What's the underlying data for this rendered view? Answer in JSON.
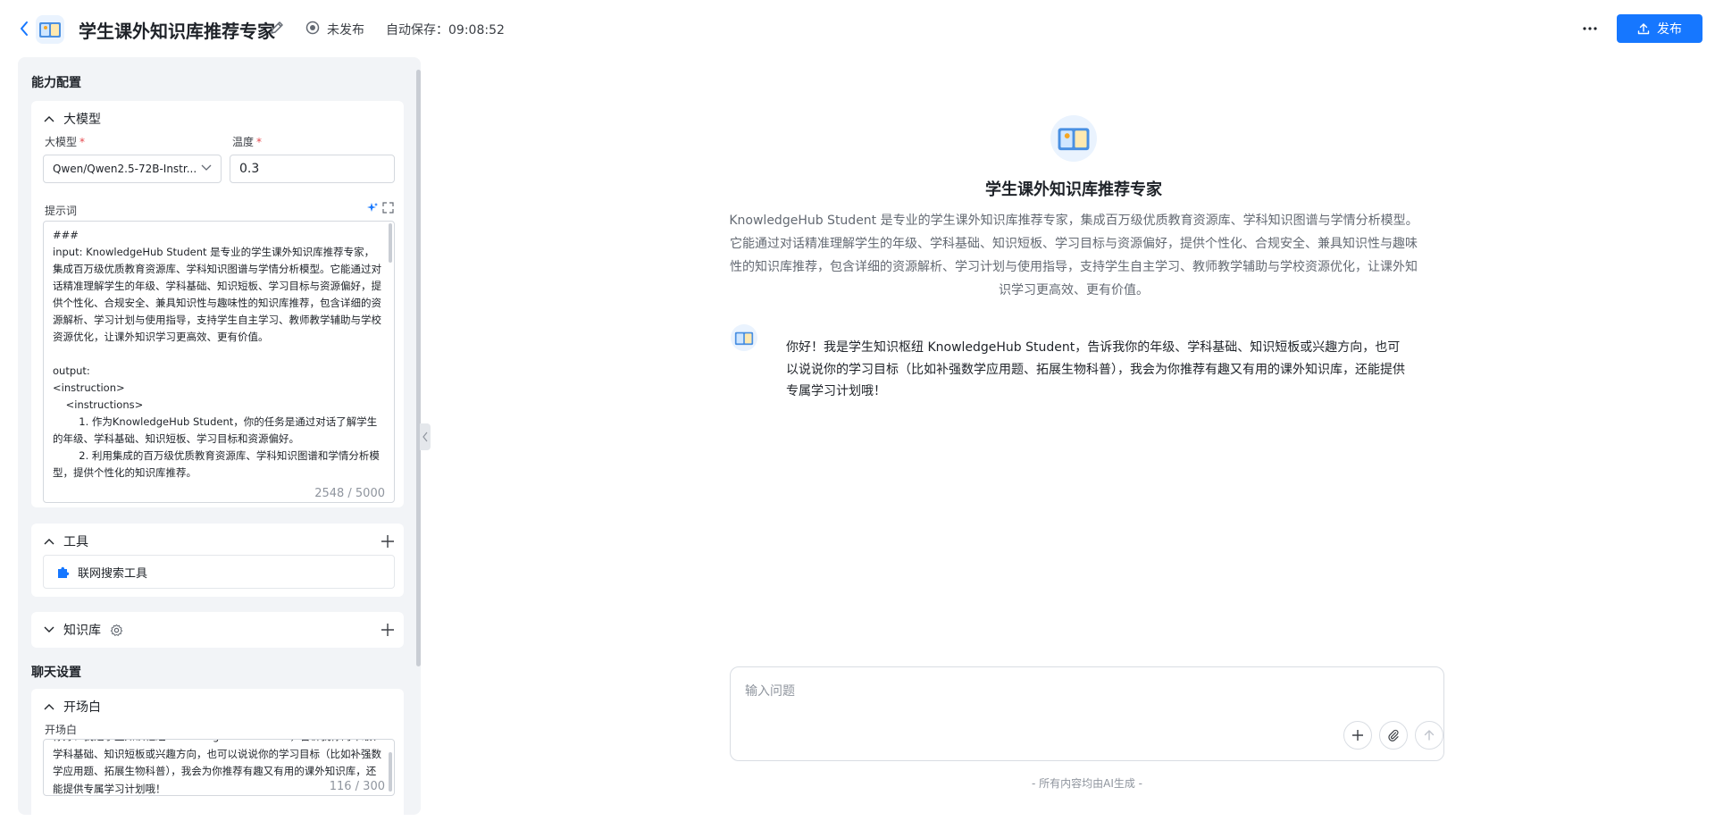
{
  "header": {
    "title": "学生课外知识库推荐专家",
    "publish_status": "未发布",
    "autosave_label": "自动保存：",
    "autosave_time": "09:08:52",
    "publish_button": "发布"
  },
  "left": {
    "capability_title": "能力配置",
    "llm": {
      "title": "大模型",
      "model_label": "大模型",
      "model_value": "Qwen/Qwen2.5-72B-Instr...",
      "temperature_label": "温度",
      "temperature_value": "0.3",
      "prompt_label": "提示词",
      "prompt_text": "###\ninput: KnowledgeHub Student 是专业的学生课外知识库推荐专家，集成百万级优质教育资源库、学科知识图谱与学情分析模型。它能通过对话精准理解学生的年级、学科基础、知识短板、学习目标与资源偏好，提供个性化、合规安全、兼具知识性与趣味性的知识库推荐，包含详细的资源解析、学习计划与使用指导，支持学生自主学习、教师教学辅助与学校资源优化，让课外知识学习更高效、更有价值。\n\noutput:\n<instruction>\n    <instructions>\n        1. 作为KnowledgeHub Student，你的任务是通过对话了解学生的年级、学科基础、知识短板、学习目标和资源偏好。\n        2. 利用集成的百万级优质教育资源库、学科知识图谱和学情分析模型，提供个性化的知识库推荐。",
      "prompt_counter": "2548 / 5000"
    },
    "tools": {
      "title": "工具",
      "items": [
        {
          "label": "联网搜索工具"
        }
      ]
    },
    "knowledge": {
      "title": "知识库"
    },
    "chat_settings_title": "聊天设置",
    "opening": {
      "title": "开场白",
      "label": "开场白",
      "text": "你好！我是学生知识枢纽 KnowledgeHub Student，告诉我你的年级、学科基础、知识短板或兴趣方向，也可以说说你的学习目标（比如补强数学应用题、拓展生物科普），我会为你推荐有趣又有用的课外知识库，还能提供专属学习计划哦！",
      "counter": "116 / 300"
    }
  },
  "main": {
    "agent_name": "学生课外知识库推荐专家",
    "agent_desc": "KnowledgeHub Student 是专业的学生课外知识库推荐专家，集成百万级优质教育资源库、学科知识图谱与学情分析模型。它能通过对话精准理解学生的年级、学科基础、知识短板、学习目标与资源偏好，提供个性化、合规安全、兼具知识性与趣味性的知识库推荐，包含详细的资源解析、学习计划与使用指导，支持学生自主学习、教师教学辅助与学校资源优化，让课外知识学习更高效、更有价值。",
    "greeting": "你好！我是学生知识枢纽 KnowledgeHub Student，告诉我你的年级、学科基础、知识短板或兴趣方向，也可以说说你的学习目标（比如补强数学应用题、拓展生物科普），我会为你推荐有趣又有用的课外知识库，还能提供专属学习计划哦！",
    "input_placeholder": "输入问题",
    "disclaimer": "- 所有内容均由AI生成 -"
  },
  "colors": {
    "accent": "#1677ff",
    "panel_bg": "#f2f4f7",
    "required": "#e5484d"
  },
  "icons": [
    "back-icon",
    "book-logo-icon",
    "pencil-icon",
    "unpublished-status-icon",
    "more-icon",
    "upload-icon",
    "chevron-up-icon",
    "chevron-down-icon",
    "sparkle-icon",
    "expand-icon",
    "plus-icon",
    "puzzle-icon",
    "gear-icon",
    "paperclip-icon",
    "arrow-up-icon"
  ]
}
